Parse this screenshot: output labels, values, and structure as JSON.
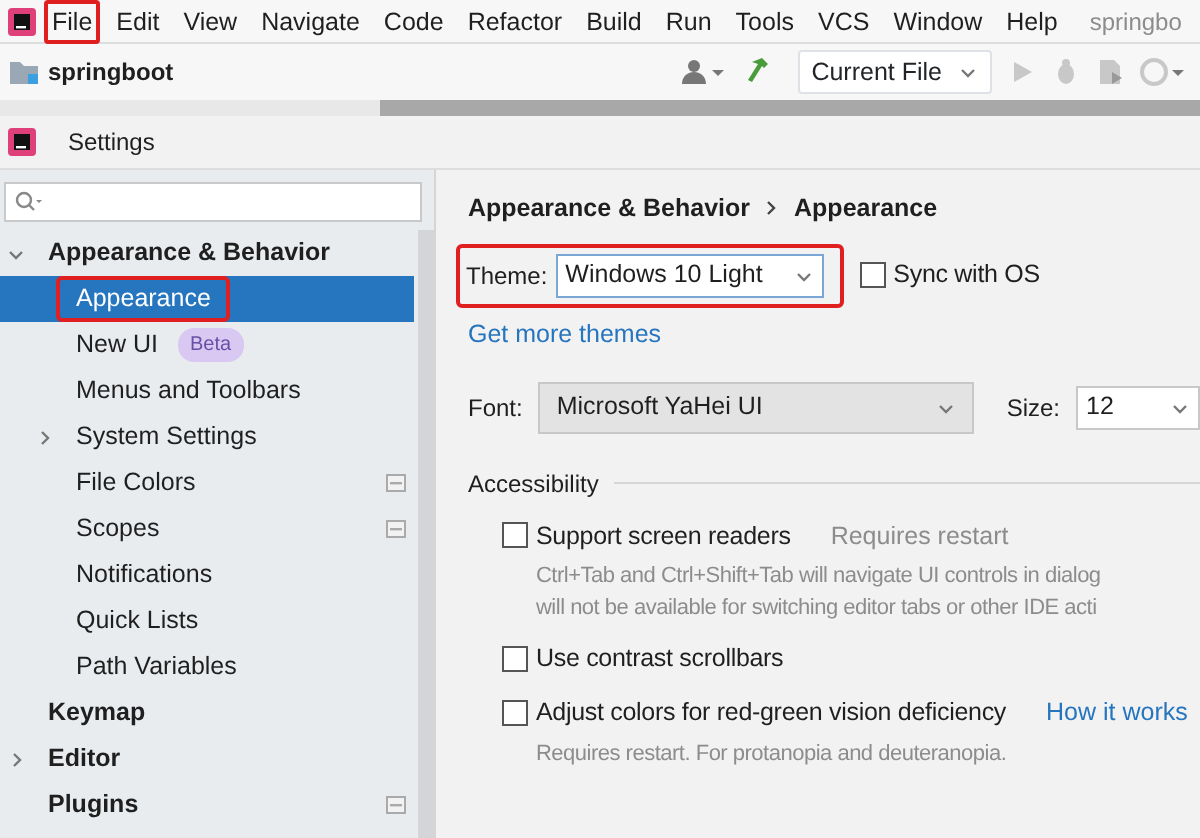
{
  "menu_bar": {
    "items": [
      {
        "label": "File",
        "highlighted": true
      },
      {
        "label": "Edit",
        "highlighted": false
      },
      {
        "label": "View",
        "highlighted": false
      },
      {
        "label": "Navigate",
        "highlighted": false
      },
      {
        "label": "Code",
        "highlighted": false
      },
      {
        "label": "Refactor",
        "highlighted": false
      },
      {
        "label": "Build",
        "highlighted": false
      },
      {
        "label": "Run",
        "highlighted": false
      },
      {
        "label": "Tools",
        "highlighted": false
      },
      {
        "label": "VCS",
        "highlighted": false
      },
      {
        "label": "Window",
        "highlighted": false
      },
      {
        "label": "Help",
        "highlighted": false
      }
    ],
    "project_title": "springbo"
  },
  "toolbar": {
    "project": "springboot",
    "run_config": "Current File"
  },
  "dialog": {
    "title": "Settings"
  },
  "sidebar": {
    "tree": [
      {
        "label": "Appearance & Behavior",
        "expanded": true,
        "selected": false,
        "highlighted": false,
        "scoped": false,
        "children": [
          {
            "label": "Appearance",
            "selected": true,
            "highlighted": true,
            "scoped": false
          },
          {
            "label": "New UI",
            "badge": "Beta",
            "selected": false,
            "highlighted": false,
            "scoped": false
          },
          {
            "label": "Menus and Toolbars",
            "selected": false,
            "highlighted": false,
            "scoped": false
          },
          {
            "label": "System Settings",
            "expanded": false,
            "selected": false,
            "highlighted": false,
            "scoped": false
          },
          {
            "label": "File Colors",
            "selected": false,
            "highlighted": false,
            "scoped": true
          },
          {
            "label": "Scopes",
            "selected": false,
            "highlighted": false,
            "scoped": true
          },
          {
            "label": "Notifications",
            "selected": false,
            "highlighted": false,
            "scoped": false
          },
          {
            "label": "Quick Lists",
            "selected": false,
            "highlighted": false,
            "scoped": false
          },
          {
            "label": "Path Variables",
            "selected": false,
            "highlighted": false,
            "scoped": false
          }
        ]
      },
      {
        "label": "Keymap",
        "selected": false,
        "highlighted": false,
        "scoped": false
      },
      {
        "label": "Editor",
        "expanded": false,
        "selected": false,
        "highlighted": false,
        "scoped": false
      },
      {
        "label": "Plugins",
        "selected": false,
        "highlighted": false,
        "scoped": true
      }
    ]
  },
  "breadcrumb": [
    "Appearance & Behavior",
    "Appearance"
  ],
  "theme": {
    "label": "Theme:",
    "value": "Windows 10 Light",
    "highlighted": true
  },
  "sync_with_os": {
    "label": "Sync with OS",
    "checked": false
  },
  "more_themes_link": "Get more themes",
  "font": {
    "label": "Font:",
    "value": "Microsoft YaHei UI"
  },
  "size": {
    "label": "Size:",
    "value": "12"
  },
  "accessibility": {
    "title": "Accessibility",
    "options": [
      {
        "label": "Support screen readers",
        "checked": false,
        "note": "Requires restart",
        "description": [
          "Ctrl+Tab and Ctrl+Shift+Tab will navigate UI controls in dialog",
          "will not be available for switching editor tabs or other IDE acti"
        ]
      },
      {
        "label": "Use contrast scrollbars",
        "checked": false
      },
      {
        "label": "Adjust colors for red-green vision deficiency",
        "checked": false,
        "link": "How it works",
        "description": [
          "Requires restart. For protanopia and deuteranopia."
        ]
      }
    ]
  }
}
